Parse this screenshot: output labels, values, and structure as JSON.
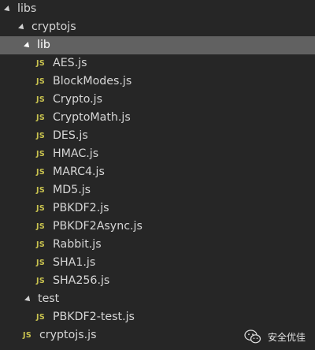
{
  "tree": {
    "root_folder": "libs",
    "crypto_folder": "cryptojs",
    "lib_folder": "lib",
    "file_icon_text": "JS",
    "lib_files": [
      "AES.js",
      "BlockModes.js",
      "Crypto.js",
      "CryptoMath.js",
      "DES.js",
      "HMAC.js",
      "MARC4.js",
      "MD5.js",
      "PBKDF2.js",
      "PBKDF2Async.js",
      "Rabbit.js",
      "SHA1.js",
      "SHA256.js"
    ],
    "test_folder": "test",
    "test_files": [
      "PBKDF2-test.js"
    ],
    "root_file": "cryptojs.js"
  },
  "watermark": {
    "text": "安全优佳",
    "icon": "wechat-logo-icon"
  },
  "colors": {
    "background": "#262626",
    "selected_row": "#616161",
    "js_icon": "#c9c34f",
    "text": "#d6d6d6"
  }
}
